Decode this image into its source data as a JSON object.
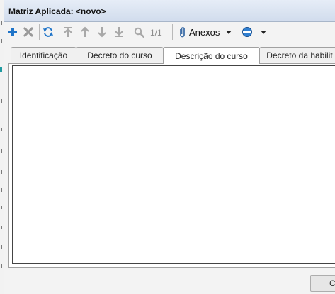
{
  "window": {
    "title": "Matriz Aplicada: <novo>"
  },
  "toolbar": {
    "counter": "1/1",
    "anexos_label": "Anexos",
    "icons": [
      "plus-icon",
      "close-icon",
      "refresh-icon",
      "first-icon",
      "up-icon",
      "down-icon",
      "last-icon",
      "search-icon",
      "paperclip-icon",
      "chevron-down-icon",
      "globe-icon",
      "chevron-down-icon"
    ]
  },
  "tabs": [
    {
      "label": "Identificação",
      "active": false
    },
    {
      "label": "Decreto do curso",
      "active": false
    },
    {
      "label": "Descrição do curso",
      "active": true
    },
    {
      "label": "Decreto da habilit",
      "active": false
    }
  ],
  "footer": {
    "button_label": "C"
  },
  "colors": {
    "accent_blue": "#1f74c8",
    "add_green": "#1f9aa0",
    "title_bg": "#dbe4f1"
  }
}
